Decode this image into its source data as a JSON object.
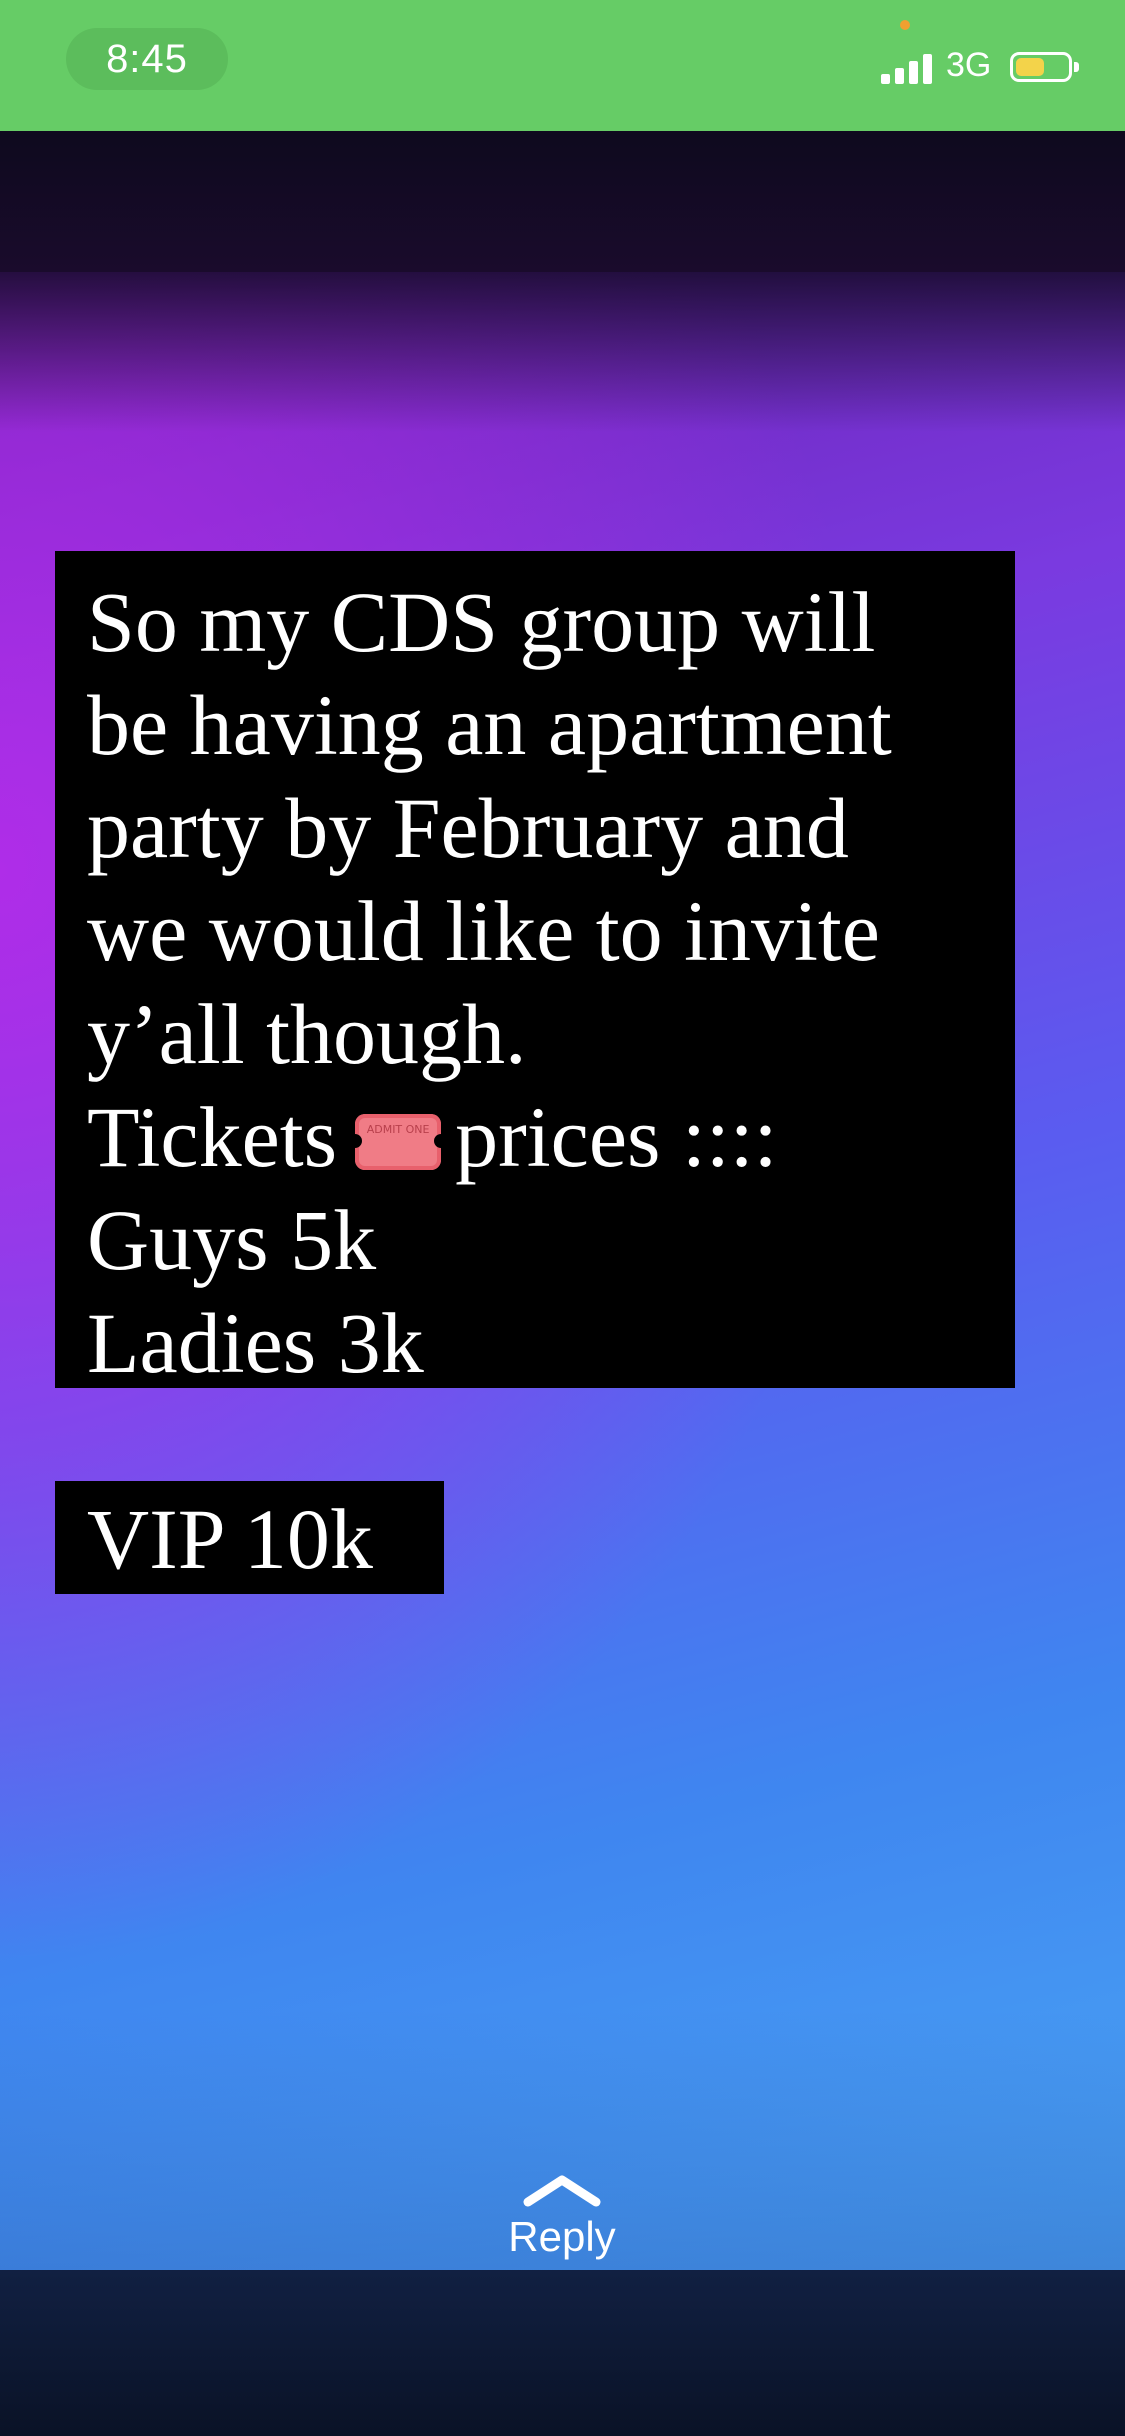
{
  "status_bar": {
    "time": "8:45",
    "network": "3G",
    "signal_bars": 4,
    "battery_level": 0.55,
    "bar_color": "#66cc66"
  },
  "story": {
    "lines": [
      "So my CDS group will",
      "be having an apartment",
      "party by February and",
      "we would like to invite",
      "y’all though."
    ],
    "tickets_word": "Tickets",
    "ticket_icon_text": "ADMIT ONE",
    "ticket_icon": "admission-ticket-icon",
    "prices_text": "prices ::::",
    "price_lines": [
      "Guys 5k",
      "Ladies 3k"
    ],
    "vip": "VIP 10k"
  },
  "reply": {
    "label": "Reply",
    "icon": "chevron-up-icon"
  }
}
